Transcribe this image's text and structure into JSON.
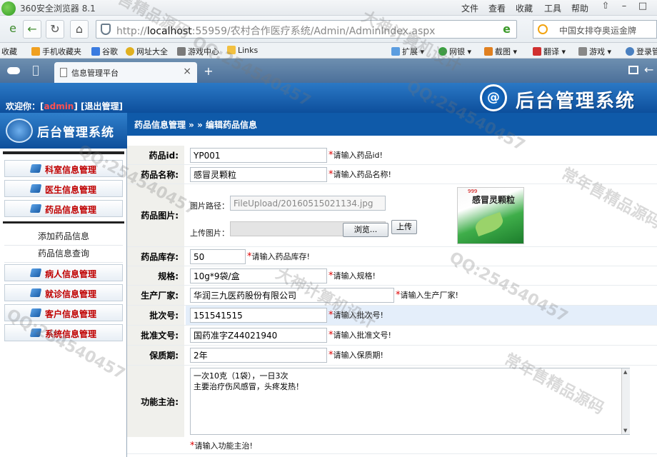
{
  "browser": {
    "app_title": "360安全浏览器 8.1",
    "menu": [
      "文件",
      "查看",
      "收藏",
      "工具",
      "帮助"
    ],
    "url_prefix": "http://",
    "url_host": "localhost",
    "url_rest": ":55959/农村合作医疗系统/Admin/AdminIndex.aspx",
    "search_text": "中国女排夺奥运金牌",
    "favorites": [
      "收藏",
      "手机收藏夹",
      "谷歌",
      "网址大全",
      "游戏中心",
      "Links",
      "扩展",
      "网银",
      "截图",
      "翻译",
      "游戏",
      "登录管"
    ],
    "tab_title": "信息管理平台",
    "tab_close": "×",
    "new_tab": "+"
  },
  "header": {
    "welcome_prefix": "欢迎你：[",
    "user": "admin",
    "welcome_suffix": "] [退出管理]",
    "logo_letter": "@",
    "title": "后台管理系统"
  },
  "sidebar": {
    "logo_title": "后台管理系统",
    "menu_top": [
      "科室信息管理",
      "医生信息管理",
      "药品信息管理"
    ],
    "submenu": [
      "添加药品信息",
      "药品信息查询"
    ],
    "menu_bottom": [
      "病人信息管理",
      "就诊信息管理",
      "客户信息管理",
      "系统信息管理"
    ]
  },
  "breadcrumb": "药品信息管理 » » 编辑药品信息",
  "form": {
    "id": {
      "label": "药品id:",
      "value": "YP001",
      "hint": "请输入药品id!"
    },
    "name": {
      "label": "药品名称:",
      "value": "感冒灵颗粒",
      "hint": "请输入药品名称!"
    },
    "image": {
      "label": "药品图片:",
      "path_label": "图片路径：",
      "path_value": "FileUpload/20160515021134.jpg",
      "upload_label": "上传图片：",
      "browse_button": "浏览...",
      "upload_button": "上传",
      "preview_title": "感冒灵颗粒",
      "preview_brand": "999"
    },
    "stock": {
      "label": "药品库存:",
      "value": "50",
      "hint": "请输入药品库存!"
    },
    "spec": {
      "label": "规格:",
      "value": "10g*9袋/盒",
      "hint": "请输入规格!"
    },
    "maker": {
      "label": "生产厂家:",
      "value": "华润三九医药股份有限公司",
      "hint": "请输入生产厂家!"
    },
    "batch": {
      "label": "批次号:",
      "value": "151541515",
      "hint": "请输入批次号!"
    },
    "approval": {
      "label": "批准文号:",
      "value": "国药准字Z44021940",
      "hint": "请输入批准文号!"
    },
    "shelf": {
      "label": "保质期:",
      "value": "2年",
      "hint": "请输入保质期!"
    },
    "function": {
      "label": "功能主治:",
      "value": "一次10克（1袋），一日3次\n主要治疗伤风感冒，头疼发热！",
      "hint": "请输入功能主治!"
    },
    "star": "*"
  },
  "watermarks": [
    "常年售精品源码",
    "QQ:254540457",
    "大神计算机设计",
    "QQ:254540457",
    "常年售精品源码",
    "QQ:254540457",
    "大神计算机设计",
    "QQ:254540457",
    "常年售精品源码",
    "QQ:254540457"
  ]
}
